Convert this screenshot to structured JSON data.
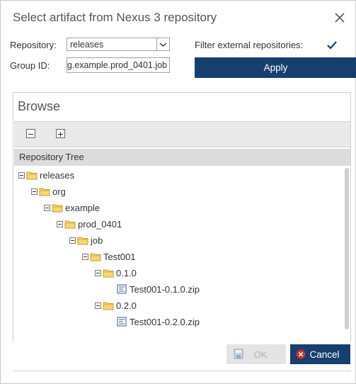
{
  "dialog": {
    "title": "Select artifact from Nexus 3 repository",
    "close_icon": "close-icon"
  },
  "form": {
    "repository_label": "Repository:",
    "repository_value": "releases",
    "group_id_label": "Group ID:",
    "group_id_value": "g.example.prod_0401.job",
    "filter_label": "Filter external repositories:",
    "filter_checked": true,
    "apply_label": "Apply"
  },
  "browse": {
    "title": "Browse",
    "collapse_all_icon": "collapse-all-icon",
    "expand_all_icon": "expand-all-icon",
    "tree_header": "Repository Tree",
    "tree": [
      {
        "label": "releases",
        "type": "folder"
      },
      {
        "label": "org",
        "type": "folder"
      },
      {
        "label": "example",
        "type": "folder"
      },
      {
        "label": "prod_0401",
        "type": "folder"
      },
      {
        "label": "job",
        "type": "folder"
      },
      {
        "label": "Test001",
        "type": "folder"
      },
      {
        "label": "0.1.0",
        "type": "folder"
      },
      {
        "label": "Test001-0.1.0.zip",
        "type": "file"
      },
      {
        "label": "0.2.0",
        "type": "folder"
      },
      {
        "label": "Test001-0.2.0.zip",
        "type": "file"
      }
    ]
  },
  "buttons": {
    "ok_label": "OK",
    "cancel_label": "Cancel"
  },
  "colors": {
    "primary": "#173f6e",
    "folder": "#f2c94c",
    "cancel_icon": "#d92b2b"
  }
}
